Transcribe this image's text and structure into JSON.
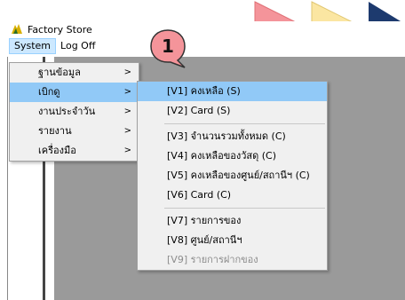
{
  "window": {
    "title": "Factory Store"
  },
  "menubar": {
    "items": [
      "System",
      "Log Off"
    ]
  },
  "system_menu": [
    {
      "label": "ฐานข้อมูล",
      "has_submenu": true
    },
    {
      "label": "เบิกดู",
      "has_submenu": true,
      "selected": true
    },
    {
      "label": "งานประจำวัน",
      "has_submenu": true
    },
    {
      "label": "รายงาน",
      "has_submenu": true
    },
    {
      "label": "เครื่องมือ",
      "has_submenu": true
    }
  ],
  "submenu": {
    "group1": [
      {
        "label": "[V1] คงเหลือ (S)",
        "selected": true
      },
      {
        "label": "[V2] Card (S)"
      }
    ],
    "group2": [
      {
        "label": "[V3] จำนวนรวมทั้งหมด (C)"
      },
      {
        "label": "[V4] คงเหลือของวัสดุ (C)"
      },
      {
        "label": "[V5] คงเหลือของศูนย์/สถานีฯ (C)"
      },
      {
        "label": "[V6] Card (C)"
      }
    ],
    "group3": [
      {
        "label": "[V7] รายการของ"
      },
      {
        "label": "[V8] ศูนย์/สถานีฯ"
      },
      {
        "label": "[V9] รายการฝากของ",
        "disabled": true
      }
    ]
  },
  "callout": {
    "number": "1"
  },
  "colors": {
    "arrow1": "#f4949a",
    "arrow2": "#fbe6a2",
    "arrow3": "#1d3a6e",
    "badge": "#f4949a",
    "highlight": "#91c9f7"
  },
  "icons": {
    "app": "factory-logo-icon",
    "submenu_arrow": "chevron-right-icon"
  }
}
